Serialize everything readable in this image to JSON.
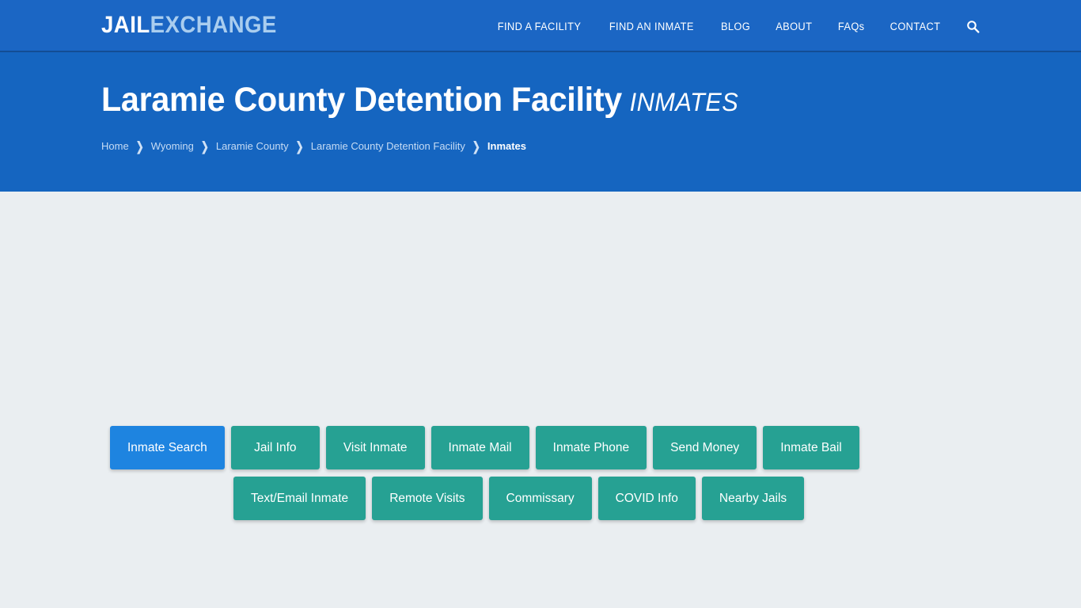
{
  "navbar": {
    "brand": {
      "part1": "JAIL",
      "part2": "EXCHANGE"
    },
    "links": [
      {
        "label": "FIND A FACILITY",
        "name": "nav-find-a-facility"
      },
      {
        "label": "FIND AN INMATE",
        "name": "nav-find-an-inmate"
      },
      {
        "label": "BLOG",
        "name": "nav-blog"
      },
      {
        "label": "ABOUT",
        "name": "nav-about"
      },
      {
        "label": "FAQs",
        "name": "nav-faqs"
      },
      {
        "label": "CONTACT",
        "name": "nav-contact"
      }
    ],
    "search_icon": "search-icon"
  },
  "header": {
    "title": "Laramie County Detention Facility",
    "title_suffix": "INMATES",
    "breadcrumb": [
      {
        "label": "Home",
        "current": false
      },
      {
        "label": "Wyoming",
        "current": false
      },
      {
        "label": "Laramie County",
        "current": false
      },
      {
        "label": "Laramie County Detention Facility",
        "current": false
      },
      {
        "label": "Inmates",
        "current": true
      }
    ],
    "separator": "❯"
  },
  "tabs": {
    "row1": [
      {
        "label": "Inmate Search",
        "active": true
      },
      {
        "label": "Jail Info",
        "active": false
      },
      {
        "label": "Visit Inmate",
        "active": false
      },
      {
        "label": "Inmate Mail",
        "active": false
      },
      {
        "label": "Inmate Phone",
        "active": false
      },
      {
        "label": "Send Money",
        "active": false
      },
      {
        "label": "Inmate Bail",
        "active": false
      }
    ],
    "row2": [
      {
        "label": "Text/Email Inmate",
        "active": false
      },
      {
        "label": "Remote Visits",
        "active": false
      },
      {
        "label": "Commissary",
        "active": false
      },
      {
        "label": "COVID Info",
        "active": false
      },
      {
        "label": "Nearby Jails",
        "active": false
      }
    ]
  },
  "colors": {
    "nav_blue": "#1b66c4",
    "header_blue": "#1565c0",
    "page_background": "#eaeef1",
    "teal_button": "#26a193",
    "active_button": "#1e84e0",
    "brand_accent": "#a9cdef"
  }
}
